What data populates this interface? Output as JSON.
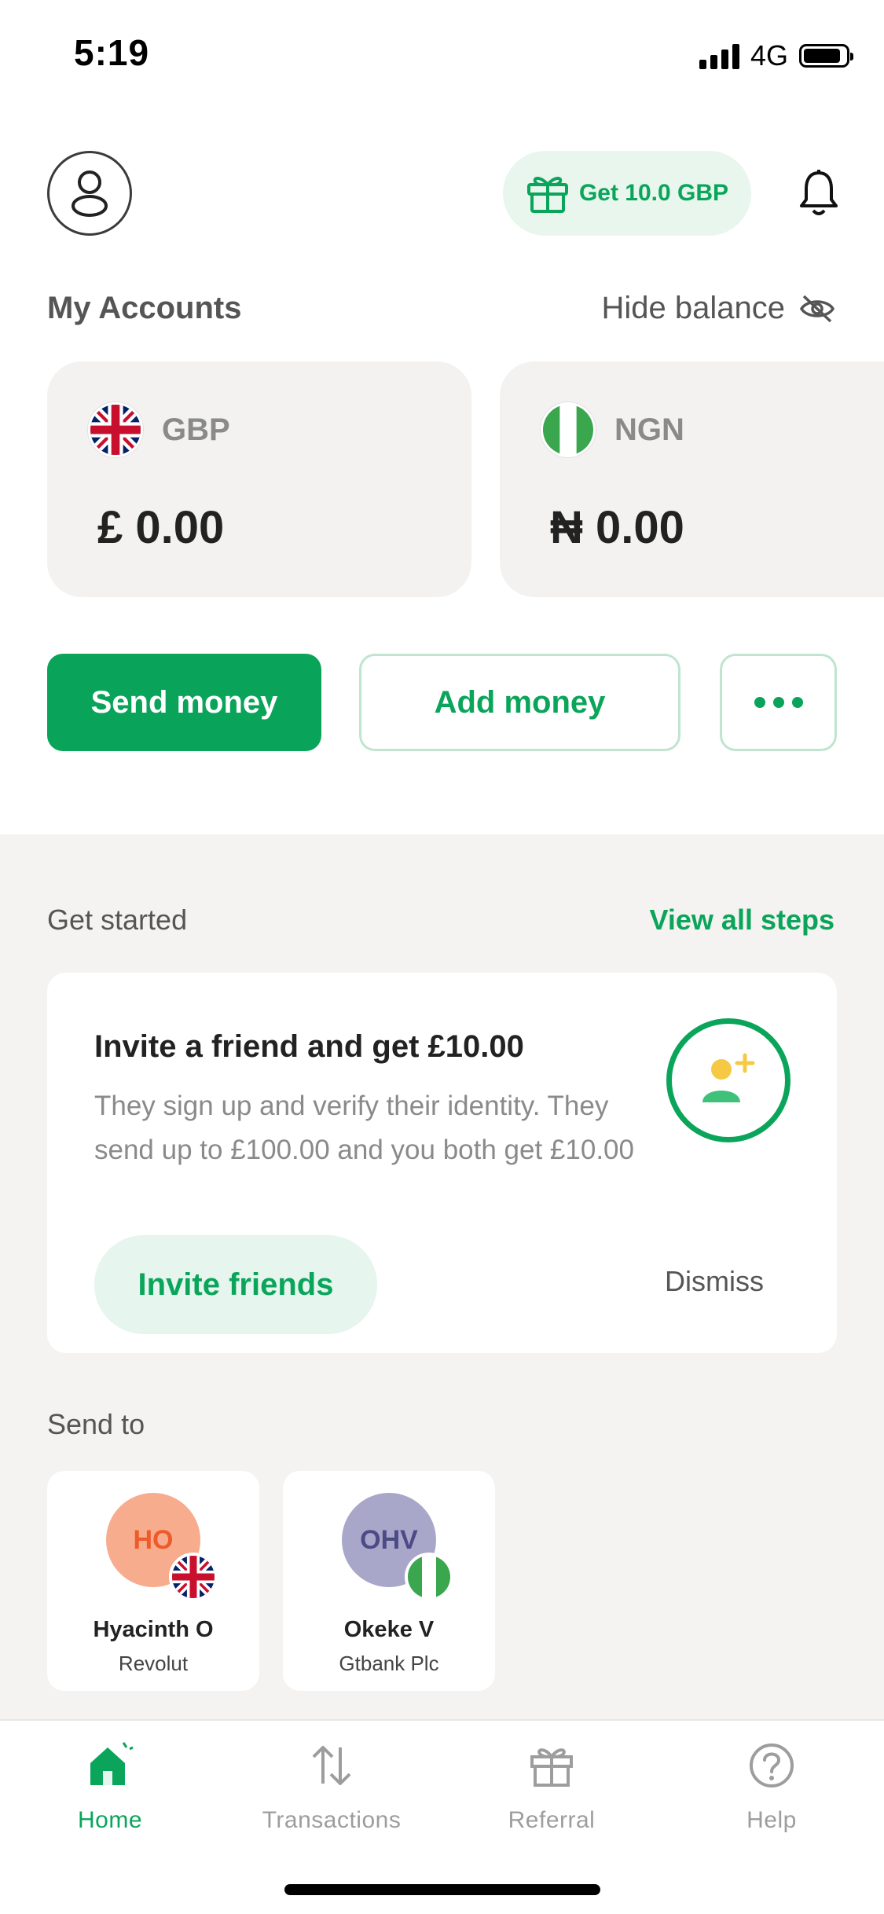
{
  "status_bar": {
    "time": "5:19",
    "network": "4G"
  },
  "header": {
    "gift_label": "Get 10.0 GBP"
  },
  "accounts": {
    "title": "My Accounts",
    "hide_balance_label": "Hide balance",
    "items": [
      {
        "code": "GBP",
        "amount": "£ 0.00",
        "flag": "uk-flag"
      },
      {
        "code": "NGN",
        "amount": "₦ 0.00",
        "flag": "nigeria-flag"
      }
    ]
  },
  "actions": {
    "send_label": "Send money",
    "add_label": "Add money"
  },
  "get_started": {
    "title": "Get started",
    "view_all_label": "View all steps",
    "card": {
      "title": "Invite a friend and get £10.00",
      "description": "They sign up and verify their identity. They send up to £100.00 and you both get £10.00",
      "cta_label": "Invite friends",
      "dismiss_label": "Dismiss"
    }
  },
  "send_to": {
    "title": "Send to",
    "recipients": [
      {
        "initials": "HO",
        "name": "Hyacinth O",
        "bank": "Revolut",
        "flag": "uk-flag"
      },
      {
        "initials": "OHV",
        "name": "Okeke V",
        "bank": "Gtbank Plc",
        "flag": "nigeria-flag"
      }
    ]
  },
  "tab_bar": {
    "tabs": [
      {
        "label": "Home",
        "icon": "home-icon",
        "active": true
      },
      {
        "label": "Transactions",
        "icon": "transactions-icon",
        "active": false
      },
      {
        "label": "Referral",
        "icon": "gift-icon",
        "active": false
      },
      {
        "label": "Help",
        "icon": "help-icon",
        "active": false
      }
    ]
  },
  "colors": {
    "brand_green": "#09a45a",
    "light_green": "#e6f5ed",
    "grey_bg": "#f4f3f1"
  }
}
